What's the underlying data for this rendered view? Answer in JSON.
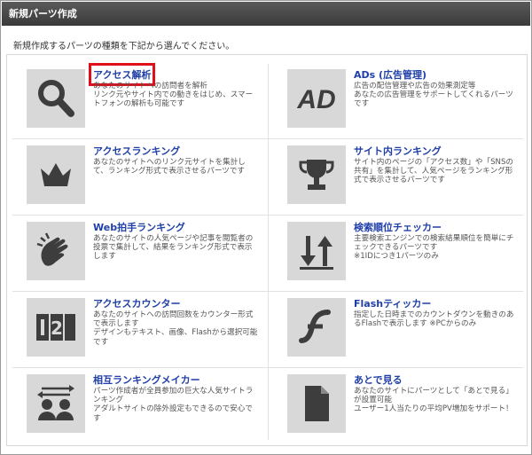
{
  "window": {
    "title": "新規パーツ作成"
  },
  "intro": "新規作成するパーツの種類を下記から選んでください。",
  "items": [
    {
      "title": "アクセス解析",
      "desc": "あなたのサイトへの訪問者を解析\nリンク元やサイト内での動きをはじめ、スマートフォンの解析も可能です",
      "icon": "magnifier-icon"
    },
    {
      "title": "ADs (広告管理)",
      "desc": "広告の配信管理や広告の効果測定等\nあなたの広告管理をサポートしてくれるパーツです",
      "icon": "ad-icon"
    },
    {
      "title": "アクセスランキング",
      "desc": "あなたのサイトへのリンク元サイトを集計して、ランキング形式で表示させるパーツです",
      "icon": "crown-icon"
    },
    {
      "title": "サイト内ランキング",
      "desc": "サイト内のページの「アクセス数」や「SNSの共有」を集計して、人気ページをランキング形式で表示させるパーツです",
      "icon": "trophy-icon"
    },
    {
      "title": "Web拍手ランキング",
      "desc": "あなたのサイトの人気ページや記事を閲覧者の投票で集計して、結果をランキング形式で表示します",
      "icon": "clapping-hands-icon"
    },
    {
      "title": "検索順位チェッカー",
      "desc": "主要検索エンジンでの検索結果順位を簡単にチェックできるパーツです\n※1IDにつき1パーツのみ",
      "icon": "sort-arrows-icon"
    },
    {
      "title": "アクセスカウンター",
      "desc": "あなたのサイトへの訪問回数をカウンター形式で表示します\nデザインもテキスト、画像、Flashから選択可能です",
      "icon": "counter-icon"
    },
    {
      "title": "Flashティッカー",
      "desc": "指定した日時までのカウントダウンを動きのあるFlashで表示します ※PCからのみ",
      "icon": "flash-icon"
    },
    {
      "title": "相互ランキングメイカー",
      "desc": "パーツ作成者が全員参加の巨大な人気サイトランキング\nアダルトサイトの除外設定もできるので安心です",
      "icon": "mutual-users-icon"
    },
    {
      "title": "あとで見る",
      "desc": "あなたのサイトにパーツとして「あとで見る」が設置可能\nユーザー1人当たりの平均PV増加をサポート！",
      "icon": "document-icon"
    }
  ],
  "colors": {
    "title_link": "#1f3fa8",
    "highlight": "#e0101a",
    "icon_bg": "#d8d8d8",
    "icon_fg": "#3d3d3d"
  }
}
